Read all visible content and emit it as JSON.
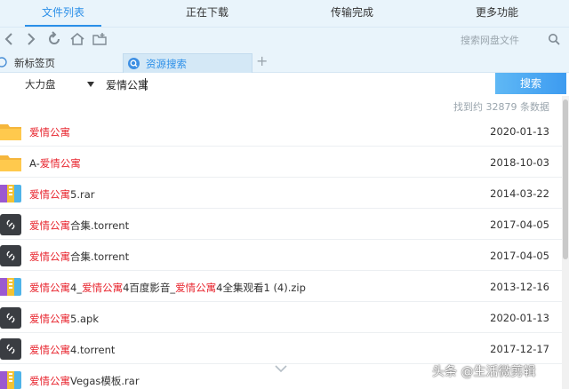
{
  "nav": {
    "tabs": [
      {
        "label": "文件列表",
        "active": true
      },
      {
        "label": "正在下载",
        "active": false
      },
      {
        "label": "传输完成",
        "active": false
      },
      {
        "label": "更多功能",
        "active": false
      }
    ]
  },
  "toolbar": {
    "search_placeholder": "搜索网盘文件",
    "icons": [
      "back-icon",
      "forward-icon",
      "refresh-icon",
      "home-icon",
      "new-folder-icon",
      "search-icon"
    ]
  },
  "browser_tabs": [
    {
      "label": "新标签页",
      "icon": "globe-icon"
    },
    {
      "label": "资源搜索",
      "icon": "search-icon",
      "active": true
    }
  ],
  "search": {
    "disk": "大力盘",
    "query": "爱情公寓",
    "button": "搜索",
    "result_count": "找到约 32879 条数据"
  },
  "results": [
    {
      "type": "folder",
      "parts": [
        {
          "t": "爱情公寓",
          "hl": true
        }
      ],
      "date": "2020-01-13"
    },
    {
      "type": "folder",
      "parts": [
        {
          "t": "A-",
          "hl": false
        },
        {
          "t": "爱情公寓",
          "hl": true
        }
      ],
      "date": "2018-10-03"
    },
    {
      "type": "archive",
      "parts": [
        {
          "t": "爱情公寓",
          "hl": true
        },
        {
          "t": "5.rar",
          "hl": false
        }
      ],
      "date": "2014-03-22"
    },
    {
      "type": "torrent",
      "parts": [
        {
          "t": "爱情公寓",
          "hl": true
        },
        {
          "t": "合集.torrent",
          "hl": false
        }
      ],
      "date": "2017-04-05"
    },
    {
      "type": "torrent",
      "parts": [
        {
          "t": "爱情公寓",
          "hl": true
        },
        {
          "t": "合集.torrent",
          "hl": false
        }
      ],
      "date": "2017-04-05"
    },
    {
      "type": "archive",
      "parts": [
        {
          "t": "爱情公寓",
          "hl": true
        },
        {
          "t": "4_",
          "hl": false
        },
        {
          "t": "爱情公寓",
          "hl": true
        },
        {
          "t": "4百度影音_",
          "hl": false
        },
        {
          "t": "爱情公寓",
          "hl": true
        },
        {
          "t": "4全集观看1 (4).zip",
          "hl": false
        }
      ],
      "date": "2013-12-16"
    },
    {
      "type": "torrent",
      "parts": [
        {
          "t": "爱情公寓",
          "hl": true
        },
        {
          "t": "5.apk",
          "hl": false
        }
      ],
      "date": "2020-01-13"
    },
    {
      "type": "torrent",
      "parts": [
        {
          "t": "爱情公寓",
          "hl": true
        },
        {
          "t": "4.torrent",
          "hl": false
        }
      ],
      "date": "2017-12-17"
    },
    {
      "type": "archive",
      "parts": [
        {
          "t": "爱情公寓",
          "hl": true
        },
        {
          "t": "Vegas模板.rar",
          "hl": false
        }
      ],
      "date": ""
    }
  ],
  "watermark": "头条 @生活微剪辑",
  "colors": {
    "accent": "#2b8fe8",
    "highlight": "#e8262f",
    "folder": "#f5b63c"
  }
}
